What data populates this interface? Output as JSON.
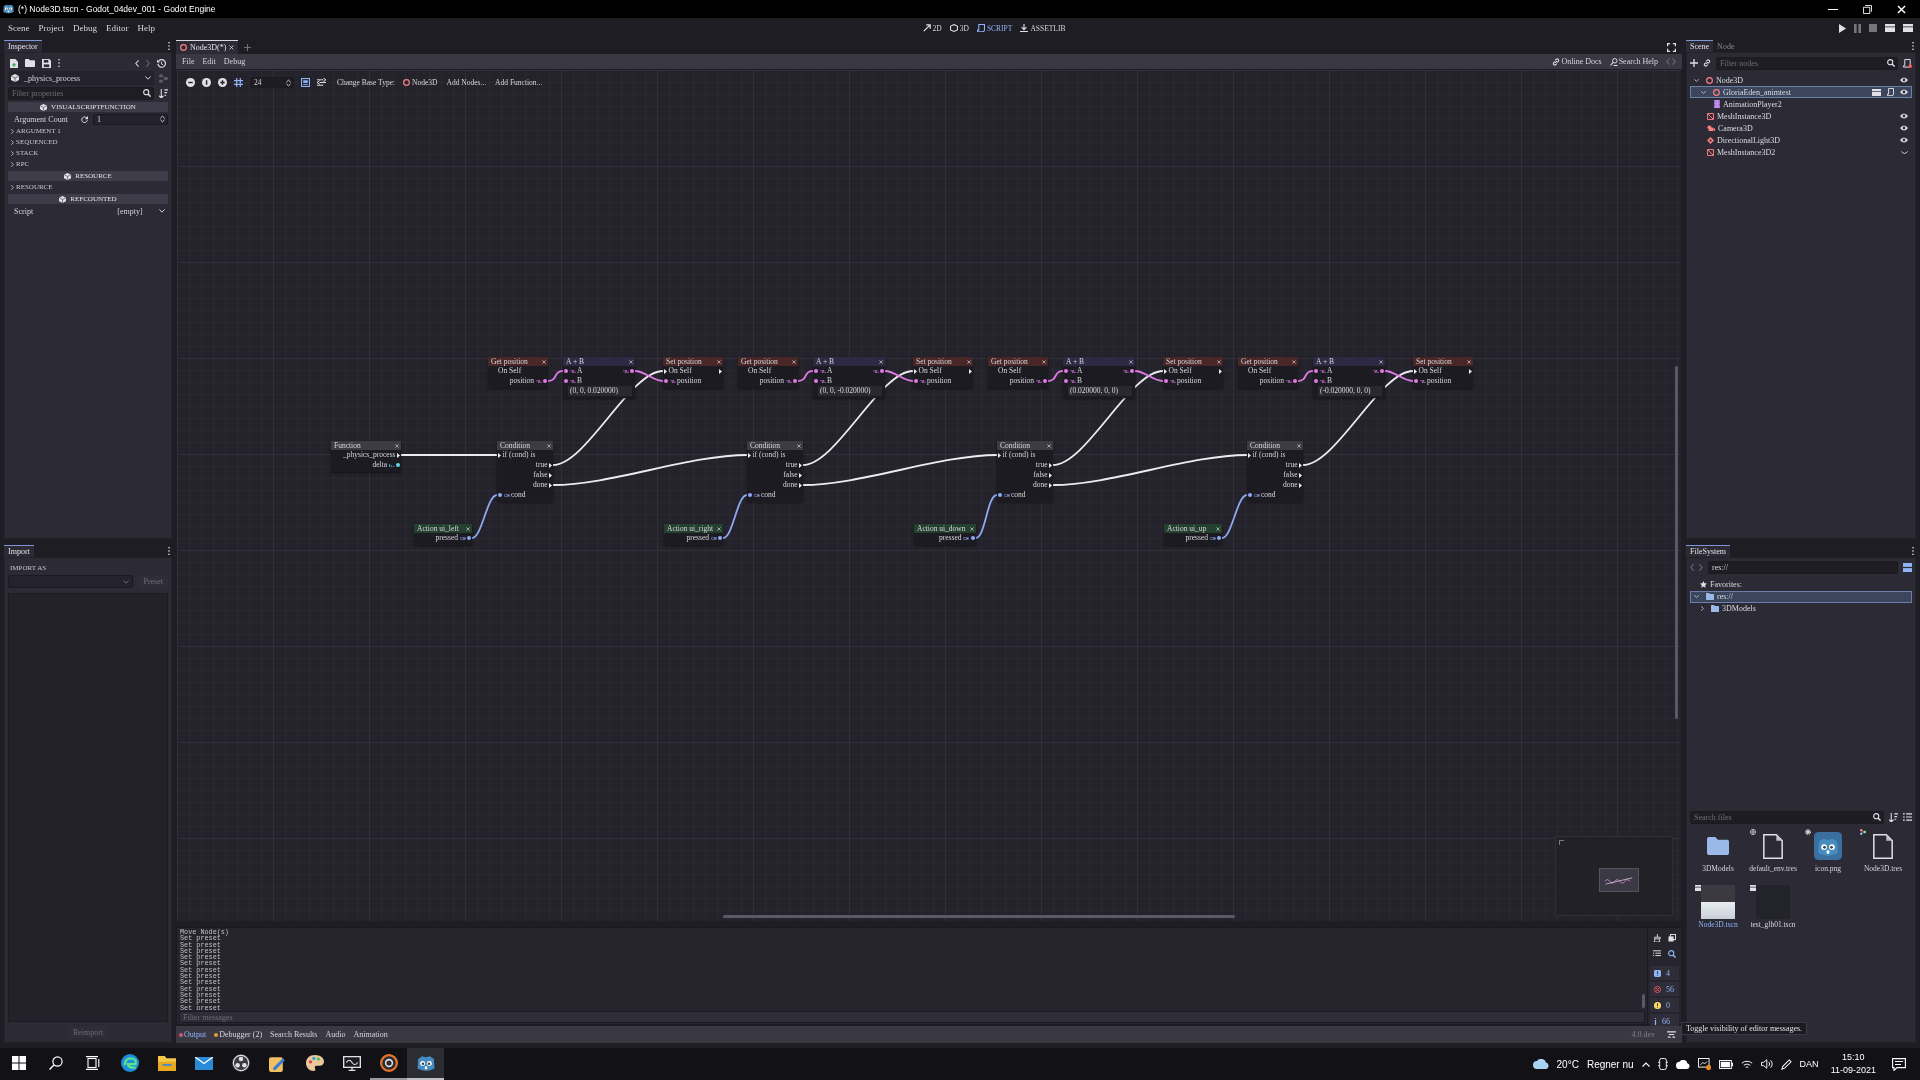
{
  "window": {
    "title": "(*) Node3D.tscn - Godot_04dev_001 - Godot Engine"
  },
  "main_menu": [
    "Scene",
    "Project",
    "Debug",
    "Editor",
    "Help"
  ],
  "workspaces": [
    {
      "kind": "canvas",
      "label": "2D",
      "selected": false
    },
    {
      "kind": "spatial",
      "label": "3D",
      "selected": false
    },
    {
      "kind": "script",
      "label": "SCRIPT",
      "selected": true
    },
    {
      "kind": "assetlib",
      "label": "ASSETLIB",
      "selected": false
    }
  ],
  "inspector": {
    "tab": "Inspector",
    "object": "_physics_process",
    "filter": {
      "placeholder": "Filter properties"
    },
    "sections": [
      {
        "title": "VISUALSCRIPTFUNCTION",
        "properties": [
          {
            "kind": "number",
            "label": "Argument Count",
            "value": "1"
          },
          {
            "kind": "group",
            "label": "ARGUMENT 1",
            "expanded": false
          },
          {
            "kind": "group",
            "label": "SEQUENCED",
            "expanded": false
          },
          {
            "kind": "group",
            "label": "STACK",
            "expanded": false
          },
          {
            "kind": "group",
            "label": "RPC",
            "expanded": false
          }
        ]
      },
      {
        "title": "RESOURCE",
        "properties": [
          {
            "kind": "group",
            "label": "RESOURCE",
            "expanded": false
          }
        ]
      },
      {
        "title": "REFCOUNTED",
        "properties": [
          {
            "kind": "resource",
            "label": "Script",
            "value": "[empty]"
          }
        ]
      }
    ]
  },
  "import": {
    "tab": "Import",
    "heading": "IMPORT AS",
    "preset": {
      "label": "Preset",
      "disabled": true
    },
    "reimport": {
      "label": "Reimport",
      "disabled": true
    }
  },
  "editor_tabs": [
    {
      "label": "Node3D(*)",
      "selected": true
    }
  ],
  "script_menu": [
    "File",
    "Edit",
    "Debug"
  ],
  "help_links": [
    {
      "kind": "docs",
      "label": "Online Docs"
    },
    {
      "kind": "search",
      "label": "Search Help"
    }
  ],
  "graph_toolbar": {
    "snap": {
      "on": true,
      "step": "24"
    },
    "minimap": {
      "on": true
    },
    "base_type_label": "Change Base Type:",
    "base_type": "Node3D",
    "buttons": [
      "Add Nodes...",
      "Add Function..."
    ]
  },
  "graph": {
    "function_node": {
      "title": "Function",
      "sequence_output": "_physics_process",
      "output": "delta"
    },
    "branches": [
      {
        "get_node": {
          "title": "Get position",
          "target": "On Self",
          "output": "position"
        },
        "add_node": {
          "title": "A + B",
          "inputs": [
            "A",
            "B"
          ],
          "value": "(0, 0, 0.020000)"
        },
        "set_node": {
          "title": "Set position",
          "target": "On Self",
          "input": "position"
        },
        "condition_node": {
          "title": "Condition",
          "sequence_input": "if (cond) is",
          "outputs": [
            "true",
            "false",
            "done"
          ],
          "input": "cond"
        },
        "action_node": {
          "title": "Action ui_left",
          "output": "pressed"
        }
      },
      {
        "get_node": {
          "title": "Get position",
          "target": "On Self",
          "output": "position"
        },
        "add_node": {
          "title": "A + B",
          "inputs": [
            "A",
            "B"
          ],
          "value": "(0, 0, -0.020000)"
        },
        "set_node": {
          "title": "Set position",
          "target": "On Self",
          "input": "position"
        },
        "condition_node": {
          "title": "Condition",
          "sequence_input": "if (cond) is",
          "outputs": [
            "true",
            "false",
            "done"
          ],
          "input": "cond"
        },
        "action_node": {
          "title": "Action ui_right",
          "output": "pressed"
        }
      },
      {
        "get_node": {
          "title": "Get position",
          "target": "On Self",
          "output": "position"
        },
        "add_node": {
          "title": "A + B",
          "inputs": [
            "A",
            "B"
          ],
          "value": "(0.020000, 0, 0)"
        },
        "set_node": {
          "title": "Set position",
          "target": "On Self",
          "input": "position"
        },
        "condition_node": {
          "title": "Condition",
          "sequence_input": "if (cond) is",
          "outputs": [
            "true",
            "false",
            "done"
          ],
          "input": "cond"
        },
        "action_node": {
          "title": "Action ui_down",
          "output": "pressed"
        }
      },
      {
        "get_node": {
          "title": "Get position",
          "target": "On Self",
          "output": "position"
        },
        "add_node": {
          "title": "A + B",
          "inputs": [
            "A",
            "B"
          ],
          "value": "(-0.020000, 0, 0)"
        },
        "set_node": {
          "title": "Set position",
          "target": "On Self",
          "input": "position"
        },
        "condition_node": {
          "title": "Condition",
          "sequence_input": "if (cond) is",
          "outputs": [
            "true",
            "false",
            "done"
          ],
          "input": "cond"
        },
        "action_node": {
          "title": "Action ui_up",
          "output": "pressed"
        }
      }
    ]
  },
  "output": {
    "lines": [
      "Move Node(s)",
      "Set preset",
      "Set preset",
      "Set preset",
      "Set preset",
      "Set preset",
      "Set preset",
      "Set preset",
      "Set preset",
      "Set preset",
      "Set preset",
      "Set preset",
      "Set preset"
    ],
    "filter": {
      "placeholder": "Filter messages"
    },
    "filters": [
      {
        "kind": "messages",
        "count": "4"
      },
      {
        "kind": "errors",
        "count": "56"
      },
      {
        "kind": "warnings",
        "count": "0"
      },
      {
        "kind": "editor",
        "count": "66"
      }
    ]
  },
  "tooltip": "Toggle visibility of editor messages.",
  "bottom_tabs": [
    {
      "label": "Output",
      "selected": true,
      "color": "#d9536f"
    },
    {
      "label": "Debugger (2)",
      "selected": false,
      "color": "#e69a3c"
    },
    {
      "label": "Search Results",
      "selected": false
    },
    {
      "label": "Audio",
      "selected": false
    },
    {
      "label": "Animation",
      "selected": false
    }
  ],
  "version": "4.0.dev",
  "scene_dock": {
    "tabs": [
      {
        "label": "Scene",
        "selected": true
      },
      {
        "label": "Node",
        "selected": false
      }
    ],
    "filter": {
      "placeholder": "Filter nodes"
    },
    "tree": [
      {
        "kind": "node3d",
        "name": "Node3D",
        "expanded": true,
        "selected": false,
        "visible": true,
        "children": [
          {
            "kind": "node3d",
            "name": "GloriaEden_animtest",
            "expanded": true,
            "selected": true,
            "scene_instance": true,
            "script": true,
            "visible": true,
            "children": [
              {
                "kind": "animation_player",
                "name": "AnimationPlayer2",
                "selected": false
              }
            ]
          },
          {
            "kind": "mesh",
            "name": "MeshInstance3D",
            "selected": false,
            "visible": true
          },
          {
            "kind": "camera",
            "name": "Camera3D",
            "selected": false,
            "visible": true
          },
          {
            "kind": "light",
            "name": "DirectionalLight3D",
            "selected": false,
            "visible": true
          },
          {
            "kind": "mesh",
            "name": "MeshInstance3D2",
            "selected": false,
            "visible": false
          }
        ]
      }
    ]
  },
  "filesystem": {
    "tab": "FileSystem",
    "path": "res://",
    "favorites": "Favorites:",
    "tree": [
      {
        "name": "res://",
        "expanded": true,
        "selected": true,
        "children": [
          {
            "name": "3DModels",
            "expanded": false,
            "selected": false
          }
        ]
      }
    ],
    "search": {
      "placeholder": "Search files"
    },
    "files": [
      {
        "kind": "folder",
        "name": "3DModels",
        "selected": false
      },
      {
        "kind": "environment",
        "name": "default_env.tres",
        "selected": false
      },
      {
        "kind": "image",
        "name": "icon.png",
        "selected": false
      },
      {
        "kind": "visual_script",
        "name": "Node3D.tres",
        "selected": false
      },
      {
        "kind": "scene",
        "name": "Node3D.tscn",
        "selected": true
      },
      {
        "kind": "scene",
        "name": "test_glb01.tscn",
        "selected": false
      }
    ]
  },
  "taskbar": {
    "items": [
      {
        "kind": "start",
        "running": false,
        "active": false
      },
      {
        "kind": "search",
        "running": false,
        "active": false
      },
      {
        "kind": "task_view",
        "running": false,
        "active": false
      },
      {
        "kind": "browser",
        "running": false,
        "active": false
      },
      {
        "kind": "files",
        "running": false,
        "active": false
      },
      {
        "kind": "mail",
        "running": false,
        "active": false
      },
      {
        "kind": "recorder",
        "running": false,
        "active": false
      },
      {
        "kind": "notes",
        "running": false,
        "active": false
      },
      {
        "kind": "paint",
        "running": false,
        "active": false
      },
      {
        "kind": "svg",
        "running": false,
        "active": false
      },
      {
        "kind": "disc",
        "running": true,
        "active": false
      },
      {
        "kind": "godot",
        "running": true,
        "active": true
      }
    ],
    "temperature": "20°C",
    "weather": "Regner nu",
    "language": "DAN",
    "time": "15:10",
    "date": "11-09-2021"
  }
}
